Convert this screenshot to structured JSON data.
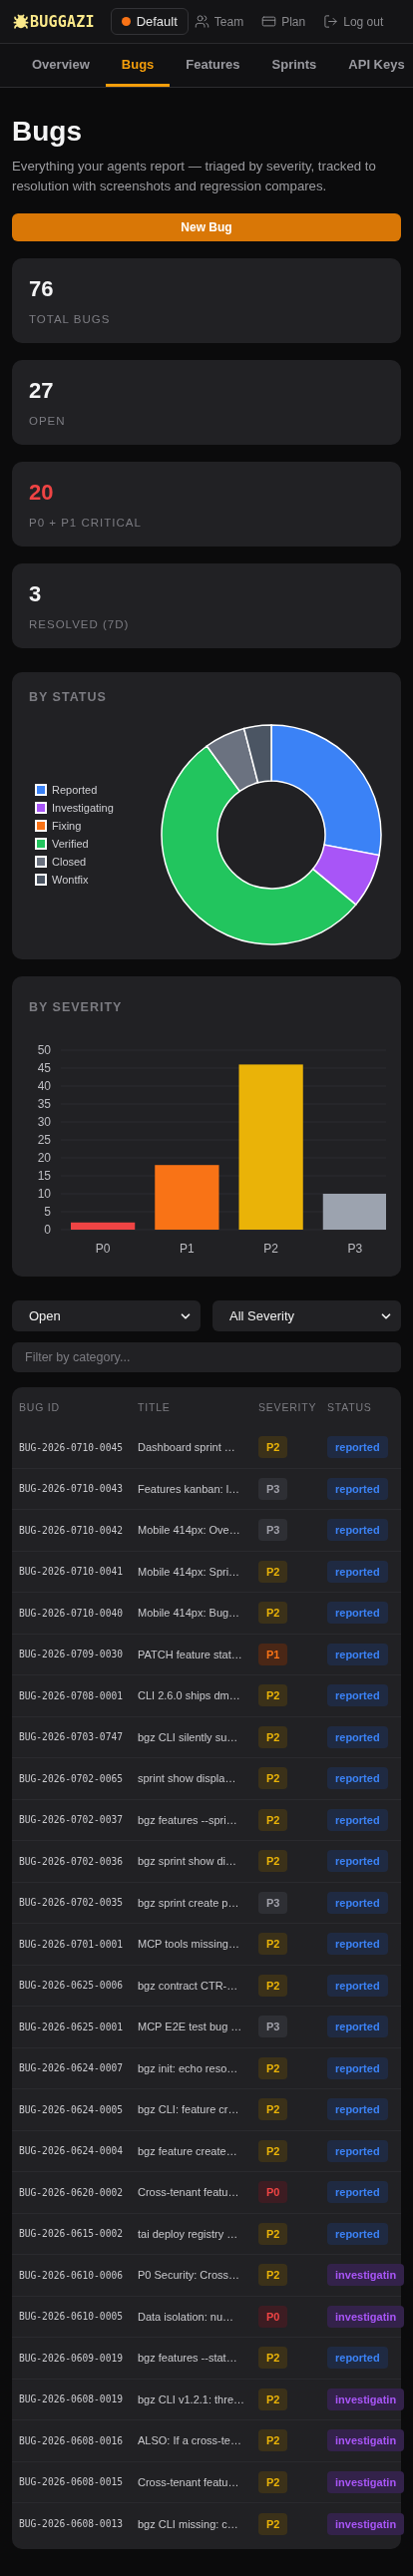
{
  "header": {
    "logo": "BUGGAZI",
    "workspace": {
      "name": "Default",
      "color": "#f97316"
    },
    "links": [
      {
        "kind": "team",
        "label": "Team"
      },
      {
        "kind": "plan",
        "label": "Plan"
      },
      {
        "kind": "logout",
        "label": "Log out"
      }
    ]
  },
  "tabs": [
    {
      "label": "Overview",
      "selected": false
    },
    {
      "label": "Bugs",
      "selected": true
    },
    {
      "label": "Features",
      "selected": false
    },
    {
      "label": "Sprints",
      "selected": false
    },
    {
      "label": "API Keys",
      "selected": false
    }
  ],
  "page": {
    "title": "Bugs",
    "subtitle": "Everything your agents report — triaged by severity, tracked to resolution with screenshots and regression compares.",
    "new_button": "New Bug"
  },
  "stats": [
    {
      "value": "76",
      "label": "TOTAL BUGS",
      "color": "#f4f4f5"
    },
    {
      "value": "27",
      "label": "OPEN",
      "color": "#f4f4f5"
    },
    {
      "value": "20",
      "label": "P0 + P1 CRITICAL",
      "color": "#ef4444"
    },
    {
      "value": "3",
      "label": "RESOLVED (7D)",
      "color": "#f4f4f5"
    }
  ],
  "status_chart": {
    "title": "BY STATUS",
    "chart_data": {
      "type": "donut",
      "categories": [
        "Reported",
        "Investigating",
        "Fixing",
        "Verified",
        "Closed",
        "Wontfix"
      ],
      "colors": [
        "#3b82f6",
        "#a855f7",
        "#f97316",
        "#22c55e",
        "#6b7280",
        "#4b5563"
      ],
      "values": [
        28,
        8,
        0,
        54,
        6,
        4
      ]
    }
  },
  "severity_chart": {
    "title": "BY SEVERITY",
    "chart_data": {
      "type": "bar",
      "categories": [
        "P0",
        "P1",
        "P2",
        "P3"
      ],
      "colors": [
        "#ef4444",
        "#f97316",
        "#eab308",
        "#9ca3af"
      ],
      "values": [
        2,
        18,
        46,
        10
      ],
      "grid": true,
      "ylim": [
        0,
        50
      ],
      "yticks": [
        0,
        5,
        10,
        15,
        20,
        25,
        30,
        35,
        40,
        45,
        50
      ]
    }
  },
  "filters": {
    "status": {
      "value": "Open"
    },
    "severity": {
      "value": "All Severity"
    },
    "category": {
      "placeholder": "Filter by category..."
    }
  },
  "table": {
    "columns": [
      "BUG ID",
      "TITLE",
      "SEVERITY",
      "STATUS"
    ],
    "rows": [
      {
        "id": "BUG-2026-0710-0045",
        "title": "Dashboard sprint …",
        "severity": {
          "label": "P2",
          "kind": "medium"
        },
        "status": {
          "label": "reported",
          "kind": "reported"
        }
      },
      {
        "id": "BUG-2026-0710-0043",
        "title": "Features kanban: l…",
        "severity": {
          "label": "P3",
          "kind": "low"
        },
        "status": {
          "label": "reported",
          "kind": "reported"
        }
      },
      {
        "id": "BUG-2026-0710-0042",
        "title": "Mobile 414px: Ove…",
        "severity": {
          "label": "P3",
          "kind": "low"
        },
        "status": {
          "label": "reported",
          "kind": "reported"
        }
      },
      {
        "id": "BUG-2026-0710-0041",
        "title": "Mobile 414px: Spri…",
        "severity": {
          "label": "P2",
          "kind": "medium"
        },
        "status": {
          "label": "reported",
          "kind": "reported"
        }
      },
      {
        "id": "BUG-2026-0710-0040",
        "title": "Mobile 414px: Bug…",
        "severity": {
          "label": "P2",
          "kind": "medium"
        },
        "status": {
          "label": "reported",
          "kind": "reported"
        }
      },
      {
        "id": "BUG-2026-0709-0030",
        "title": "PATCH feature stat…",
        "severity": {
          "label": "P1",
          "kind": "high"
        },
        "status": {
          "label": "reported",
          "kind": "reported"
        }
      },
      {
        "id": "BUG-2026-0708-0001",
        "title": "CLI 2.6.0 ships dm…",
        "severity": {
          "label": "P2",
          "kind": "medium"
        },
        "status": {
          "label": "reported",
          "kind": "reported"
        }
      },
      {
        "id": "BUG-2026-0703-0747",
        "title": "bgz CLI silently su…",
        "severity": {
          "label": "P2",
          "kind": "medium"
        },
        "status": {
          "label": "reported",
          "kind": "reported"
        }
      },
      {
        "id": "BUG-2026-0702-0065",
        "title": "sprint show displa…",
        "severity": {
          "label": "P2",
          "kind": "medium"
        },
        "status": {
          "label": "reported",
          "kind": "reported"
        }
      },
      {
        "id": "BUG-2026-0702-0037",
        "title": "bgz features --spri…",
        "severity": {
          "label": "P2",
          "kind": "medium"
        },
        "status": {
          "label": "reported",
          "kind": "reported"
        }
      },
      {
        "id": "BUG-2026-0702-0036",
        "title": "bgz sprint show di…",
        "severity": {
          "label": "P2",
          "kind": "medium"
        },
        "status": {
          "label": "reported",
          "kind": "reported"
        }
      },
      {
        "id": "BUG-2026-0702-0035",
        "title": "bgz sprint create p…",
        "severity": {
          "label": "P3",
          "kind": "low"
        },
        "status": {
          "label": "reported",
          "kind": "reported"
        }
      },
      {
        "id": "BUG-2026-0701-0001",
        "title": "MCP tools missing…",
        "severity": {
          "label": "P2",
          "kind": "medium"
        },
        "status": {
          "label": "reported",
          "kind": "reported"
        }
      },
      {
        "id": "BUG-2026-0625-0006",
        "title": "bgz contract CTR-…",
        "severity": {
          "label": "P2",
          "kind": "medium"
        },
        "status": {
          "label": "reported",
          "kind": "reported"
        }
      },
      {
        "id": "BUG-2026-0625-0001",
        "title": "MCP E2E test bug …",
        "severity": {
          "label": "P3",
          "kind": "low"
        },
        "status": {
          "label": "reported",
          "kind": "reported"
        }
      },
      {
        "id": "BUG-2026-0624-0007",
        "title": "bgz init: echo reso…",
        "severity": {
          "label": "P2",
          "kind": "medium"
        },
        "status": {
          "label": "reported",
          "kind": "reported"
        }
      },
      {
        "id": "BUG-2026-0624-0005",
        "title": "bgz CLI: feature cr…",
        "severity": {
          "label": "P2",
          "kind": "medium"
        },
        "status": {
          "label": "reported",
          "kind": "reported"
        }
      },
      {
        "id": "BUG-2026-0624-0004",
        "title": "bgz feature create…",
        "severity": {
          "label": "P2",
          "kind": "medium"
        },
        "status": {
          "label": "reported",
          "kind": "reported"
        }
      },
      {
        "id": "BUG-2026-0620-0002",
        "title": "Cross-tenant featu…",
        "severity": {
          "label": "P0",
          "kind": "critical"
        },
        "status": {
          "label": "reported",
          "kind": "reported"
        }
      },
      {
        "id": "BUG-2026-0615-0002",
        "title": "tai deploy registry …",
        "severity": {
          "label": "P2",
          "kind": "medium"
        },
        "status": {
          "label": "reported",
          "kind": "reported"
        }
      },
      {
        "id": "BUG-2026-0610-0006",
        "title": "P0 Security: Cross…",
        "severity": {
          "label": "P2",
          "kind": "medium"
        },
        "status": {
          "label": "investigatin",
          "kind": "investigating"
        }
      },
      {
        "id": "BUG-2026-0610-0005",
        "title": "Data isolation: nu…",
        "severity": {
          "label": "P0",
          "kind": "critical"
        },
        "status": {
          "label": "investigatin",
          "kind": "investigating"
        }
      },
      {
        "id": "BUG-2026-0609-0019",
        "title": "bgz features --stat…",
        "severity": {
          "label": "P2",
          "kind": "medium"
        },
        "status": {
          "label": "reported",
          "kind": "reported"
        }
      },
      {
        "id": "BUG-2026-0608-0019",
        "title": "bgz CLI v1.2.1: thre…",
        "severity": {
          "label": "P2",
          "kind": "medium"
        },
        "status": {
          "label": "investigatin",
          "kind": "investigating"
        }
      },
      {
        "id": "BUG-2026-0608-0016",
        "title": "ALSO: If a cross-te…",
        "severity": {
          "label": "P2",
          "kind": "medium"
        },
        "status": {
          "label": "investigatin",
          "kind": "investigating"
        }
      },
      {
        "id": "BUG-2026-0608-0015",
        "title": "Cross-tenant featu…",
        "severity": {
          "label": "P2",
          "kind": "medium"
        },
        "status": {
          "label": "investigatin",
          "kind": "investigating"
        }
      },
      {
        "id": "BUG-2026-0608-0013",
        "title": "bgz CLI missing: c…",
        "severity": {
          "label": "P2",
          "kind": "medium"
        },
        "status": {
          "label": "investigatin",
          "kind": "investigating"
        }
      }
    ]
  }
}
